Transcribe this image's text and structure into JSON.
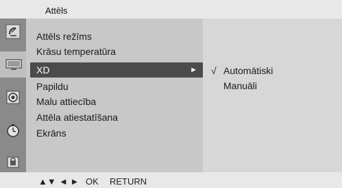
{
  "title": "Attēls",
  "menu": {
    "items": [
      {
        "label": "Attēls režīms"
      },
      {
        "label": "Krāsu temperatūra"
      },
      {
        "label": "XD"
      },
      {
        "label": "Papildu"
      },
      {
        "label": "Malu attiecība"
      },
      {
        "label": "Attēla atiestatīšana"
      },
      {
        "label": "Ekrāns"
      }
    ],
    "selected_index": 2
  },
  "submenu": {
    "items": [
      {
        "label": "Automātiski",
        "checked": true,
        "check_mark": "√"
      },
      {
        "label": "Manuāli",
        "checked": false
      }
    ]
  },
  "side_icons": [
    "satellite-dish-icon",
    "tv-screen-icon",
    "speaker-icon",
    "clock-icon",
    "lock-icon"
  ],
  "footer": {
    "nav_updown": "▲▼",
    "nav_leftright": "◄ ►",
    "ok": "OK",
    "return": "RETURN"
  },
  "colors": {
    "selected_bg": "#4b4b4b",
    "menu_bg": "#c8c8c8",
    "submenu_bg": "#d7d7d7",
    "sidebar_bg": "#8a8a8a"
  }
}
